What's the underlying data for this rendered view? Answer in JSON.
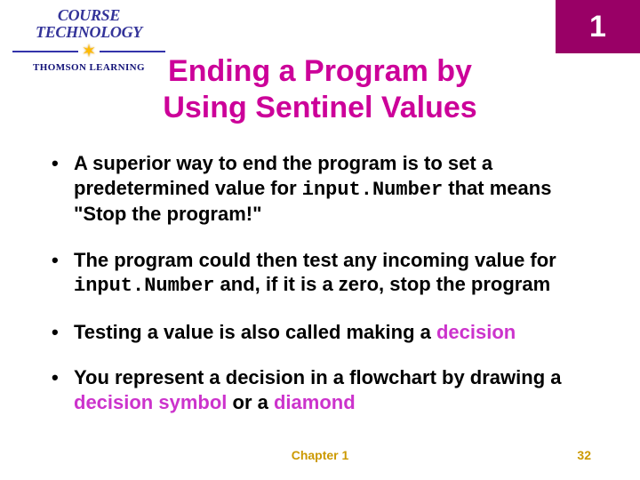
{
  "logo": {
    "line1": "COURSE",
    "line2": "TECHNOLOGY",
    "sub": "THOMSON LEARNING"
  },
  "badge": "1",
  "title_line1": "Ending a Program by",
  "title_line2": "Using Sentinel Values",
  "bullets": {
    "b1a": "A superior way to end the program is to set a predetermined value for ",
    "b1code": "input.Number",
    "b1b": " that means \"Stop the program!\"",
    "b2a": "The program could then test any incoming value for ",
    "b2code": "input.Number",
    "b2b": " and, if it is a zero, stop the program",
    "b3a": "Testing a value is also called making a ",
    "b3hl": "decision",
    "b4a": "You represent a decision in a flowchart by drawing a ",
    "b4hl1": "decision symbol",
    "b4b": " or a ",
    "b4hl2": "diamond"
  },
  "footer": {
    "chapter": "Chapter 1",
    "page": "32"
  }
}
